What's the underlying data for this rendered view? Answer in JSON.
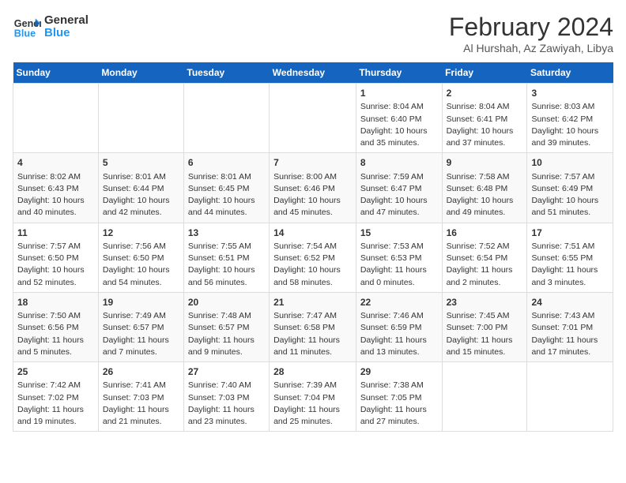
{
  "logo": {
    "line1": "General",
    "line2": "Blue"
  },
  "title": "February 2024",
  "subtitle": "Al Hurshah, Az Zawiyah, Libya",
  "days_of_week": [
    "Sunday",
    "Monday",
    "Tuesday",
    "Wednesday",
    "Thursday",
    "Friday",
    "Saturday"
  ],
  "weeks": [
    [
      {
        "day": "",
        "content": ""
      },
      {
        "day": "",
        "content": ""
      },
      {
        "day": "",
        "content": ""
      },
      {
        "day": "",
        "content": ""
      },
      {
        "day": "1",
        "content": "Sunrise: 8:04 AM\nSunset: 6:40 PM\nDaylight: 10 hours and 35 minutes."
      },
      {
        "day": "2",
        "content": "Sunrise: 8:04 AM\nSunset: 6:41 PM\nDaylight: 10 hours and 37 minutes."
      },
      {
        "day": "3",
        "content": "Sunrise: 8:03 AM\nSunset: 6:42 PM\nDaylight: 10 hours and 39 minutes."
      }
    ],
    [
      {
        "day": "4",
        "content": "Sunrise: 8:02 AM\nSunset: 6:43 PM\nDaylight: 10 hours and 40 minutes."
      },
      {
        "day": "5",
        "content": "Sunrise: 8:01 AM\nSunset: 6:44 PM\nDaylight: 10 hours and 42 minutes."
      },
      {
        "day": "6",
        "content": "Sunrise: 8:01 AM\nSunset: 6:45 PM\nDaylight: 10 hours and 44 minutes."
      },
      {
        "day": "7",
        "content": "Sunrise: 8:00 AM\nSunset: 6:46 PM\nDaylight: 10 hours and 45 minutes."
      },
      {
        "day": "8",
        "content": "Sunrise: 7:59 AM\nSunset: 6:47 PM\nDaylight: 10 hours and 47 minutes."
      },
      {
        "day": "9",
        "content": "Sunrise: 7:58 AM\nSunset: 6:48 PM\nDaylight: 10 hours and 49 minutes."
      },
      {
        "day": "10",
        "content": "Sunrise: 7:57 AM\nSunset: 6:49 PM\nDaylight: 10 hours and 51 minutes."
      }
    ],
    [
      {
        "day": "11",
        "content": "Sunrise: 7:57 AM\nSunset: 6:50 PM\nDaylight: 10 hours and 52 minutes."
      },
      {
        "day": "12",
        "content": "Sunrise: 7:56 AM\nSunset: 6:50 PM\nDaylight: 10 hours and 54 minutes."
      },
      {
        "day": "13",
        "content": "Sunrise: 7:55 AM\nSunset: 6:51 PM\nDaylight: 10 hours and 56 minutes."
      },
      {
        "day": "14",
        "content": "Sunrise: 7:54 AM\nSunset: 6:52 PM\nDaylight: 10 hours and 58 minutes."
      },
      {
        "day": "15",
        "content": "Sunrise: 7:53 AM\nSunset: 6:53 PM\nDaylight: 11 hours and 0 minutes."
      },
      {
        "day": "16",
        "content": "Sunrise: 7:52 AM\nSunset: 6:54 PM\nDaylight: 11 hours and 2 minutes."
      },
      {
        "day": "17",
        "content": "Sunrise: 7:51 AM\nSunset: 6:55 PM\nDaylight: 11 hours and 3 minutes."
      }
    ],
    [
      {
        "day": "18",
        "content": "Sunrise: 7:50 AM\nSunset: 6:56 PM\nDaylight: 11 hours and 5 minutes."
      },
      {
        "day": "19",
        "content": "Sunrise: 7:49 AM\nSunset: 6:57 PM\nDaylight: 11 hours and 7 minutes."
      },
      {
        "day": "20",
        "content": "Sunrise: 7:48 AM\nSunset: 6:57 PM\nDaylight: 11 hours and 9 minutes."
      },
      {
        "day": "21",
        "content": "Sunrise: 7:47 AM\nSunset: 6:58 PM\nDaylight: 11 hours and 11 minutes."
      },
      {
        "day": "22",
        "content": "Sunrise: 7:46 AM\nSunset: 6:59 PM\nDaylight: 11 hours and 13 minutes."
      },
      {
        "day": "23",
        "content": "Sunrise: 7:45 AM\nSunset: 7:00 PM\nDaylight: 11 hours and 15 minutes."
      },
      {
        "day": "24",
        "content": "Sunrise: 7:43 AM\nSunset: 7:01 PM\nDaylight: 11 hours and 17 minutes."
      }
    ],
    [
      {
        "day": "25",
        "content": "Sunrise: 7:42 AM\nSunset: 7:02 PM\nDaylight: 11 hours and 19 minutes."
      },
      {
        "day": "26",
        "content": "Sunrise: 7:41 AM\nSunset: 7:03 PM\nDaylight: 11 hours and 21 minutes."
      },
      {
        "day": "27",
        "content": "Sunrise: 7:40 AM\nSunset: 7:03 PM\nDaylight: 11 hours and 23 minutes."
      },
      {
        "day": "28",
        "content": "Sunrise: 7:39 AM\nSunset: 7:04 PM\nDaylight: 11 hours and 25 minutes."
      },
      {
        "day": "29",
        "content": "Sunrise: 7:38 AM\nSunset: 7:05 PM\nDaylight: 11 hours and 27 minutes."
      },
      {
        "day": "",
        "content": ""
      },
      {
        "day": "",
        "content": ""
      }
    ]
  ]
}
